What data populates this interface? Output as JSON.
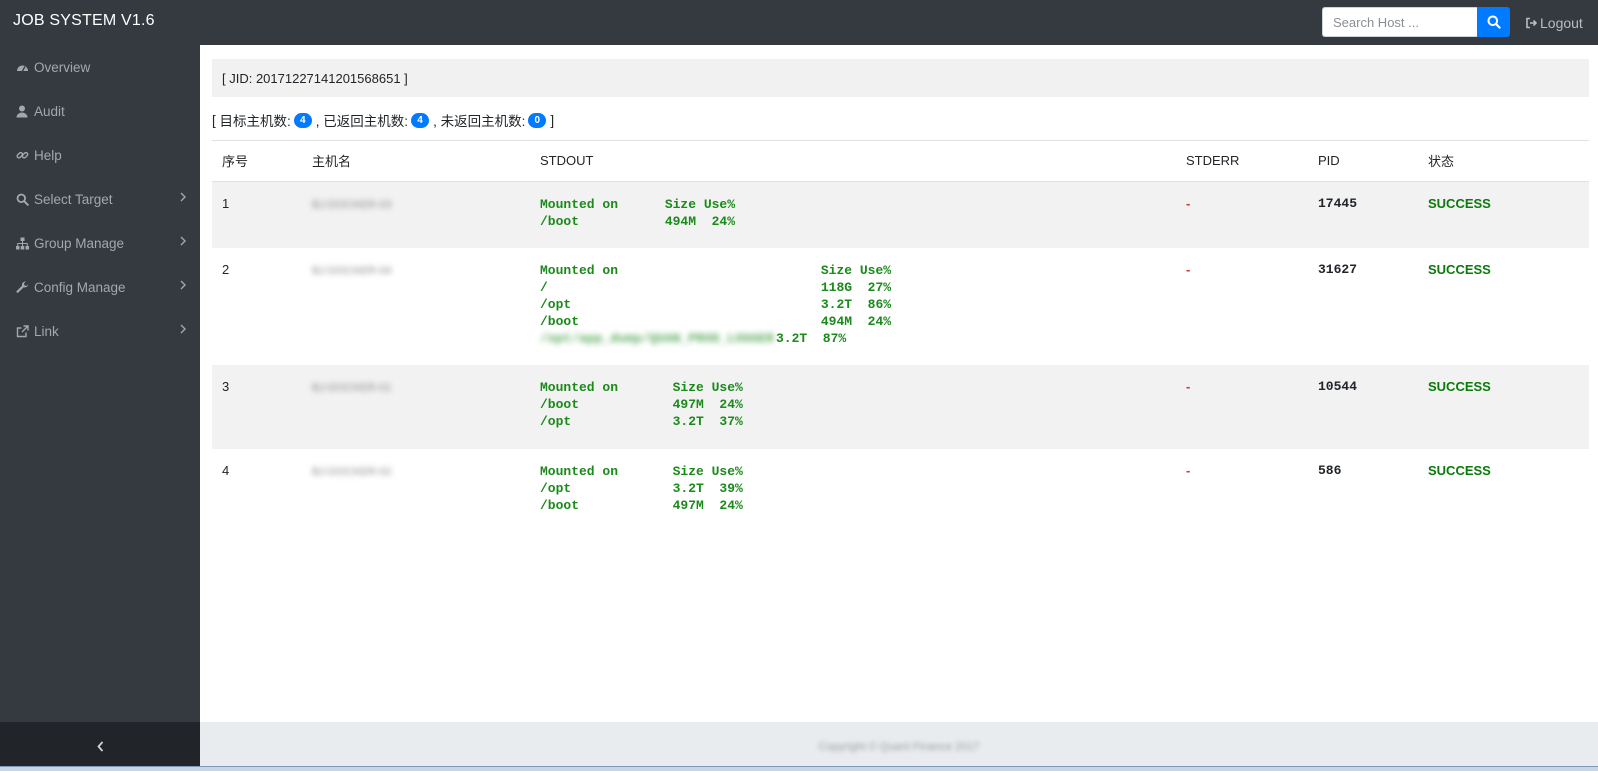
{
  "app": {
    "title": "JOB SYSTEM V1.6"
  },
  "header": {
    "search_placeholder": "Search Host ...",
    "logout_label": "Logout"
  },
  "sidebar": {
    "items": [
      {
        "label": "Overview",
        "icon": "dashboard-icon",
        "submenu": false
      },
      {
        "label": "Audit",
        "icon": "user-icon",
        "submenu": false
      },
      {
        "label": "Help",
        "icon": "link-icon",
        "submenu": false
      },
      {
        "label": "Select Target",
        "icon": "search-icon",
        "submenu": true
      },
      {
        "label": "Group Manage",
        "icon": "sitemap-icon",
        "submenu": true
      },
      {
        "label": "Config Manage",
        "icon": "wrench-icon",
        "submenu": true
      },
      {
        "label": "Link",
        "icon": "external-link-icon",
        "submenu": true
      }
    ],
    "collapse_glyph": "‹"
  },
  "job": {
    "jid_text": "[ JID: 20171227141201568651 ]",
    "summary": {
      "open": "[",
      "target_label": "目标主机数:",
      "target_count": "4",
      "returned_label": ", 已返回主机数:",
      "returned_count": "4",
      "unreturned_label": ", 未返回主机数:",
      "unreturned_count": "0",
      "close": "]"
    }
  },
  "table": {
    "headers": [
      "序号",
      "主机名",
      "STDOUT",
      "STDERR",
      "PID",
      "状态"
    ],
    "rows": [
      {
        "index": "1",
        "hostname": "BJ-DOCKER-03",
        "stdout": [
          "Mounted on      Size Use%",
          "/boot           494M  24%"
        ],
        "stdout_blurred": [],
        "stderr": "-",
        "pid": "17445",
        "status": "SUCCESS"
      },
      {
        "index": "2",
        "hostname": "BJ-DOCKER-04",
        "stdout": [
          "Mounted on                          Size Use%",
          "/                                   118G  27%",
          "/opt                                3.2T  86%",
          "/boot                               494M  24%"
        ],
        "stdout_blurred": [
          "/opt/app_dump/QUAN_PROD_LOGGER",
          "3.2T  87%"
        ],
        "stderr": "-",
        "pid": "31627",
        "status": "SUCCESS"
      },
      {
        "index": "3",
        "hostname": "BJ-DOCKER-01",
        "stdout": [
          "Mounted on       Size Use%",
          "/boot            497M  24%",
          "/opt             3.2T  37%"
        ],
        "stdout_blurred": [],
        "stderr": "-",
        "pid": "10544",
        "status": "SUCCESS"
      },
      {
        "index": "4",
        "hostname": "BJ-DOCKER-02",
        "stdout": [
          "Mounted on       Size Use%",
          "/opt             3.2T  39%",
          "/boot            497M  24%"
        ],
        "stdout_blurred": [],
        "stderr": "-",
        "pid": "586",
        "status": "SUCCESS"
      }
    ]
  },
  "footer": {
    "text": "Copyright © Quant Finance 2017"
  },
  "colors": {
    "navbar": "#343a40",
    "accent": "#007bff",
    "success": "#0b7a0b",
    "stdout": "#1a8a1a",
    "stderr": "#d9343a"
  }
}
